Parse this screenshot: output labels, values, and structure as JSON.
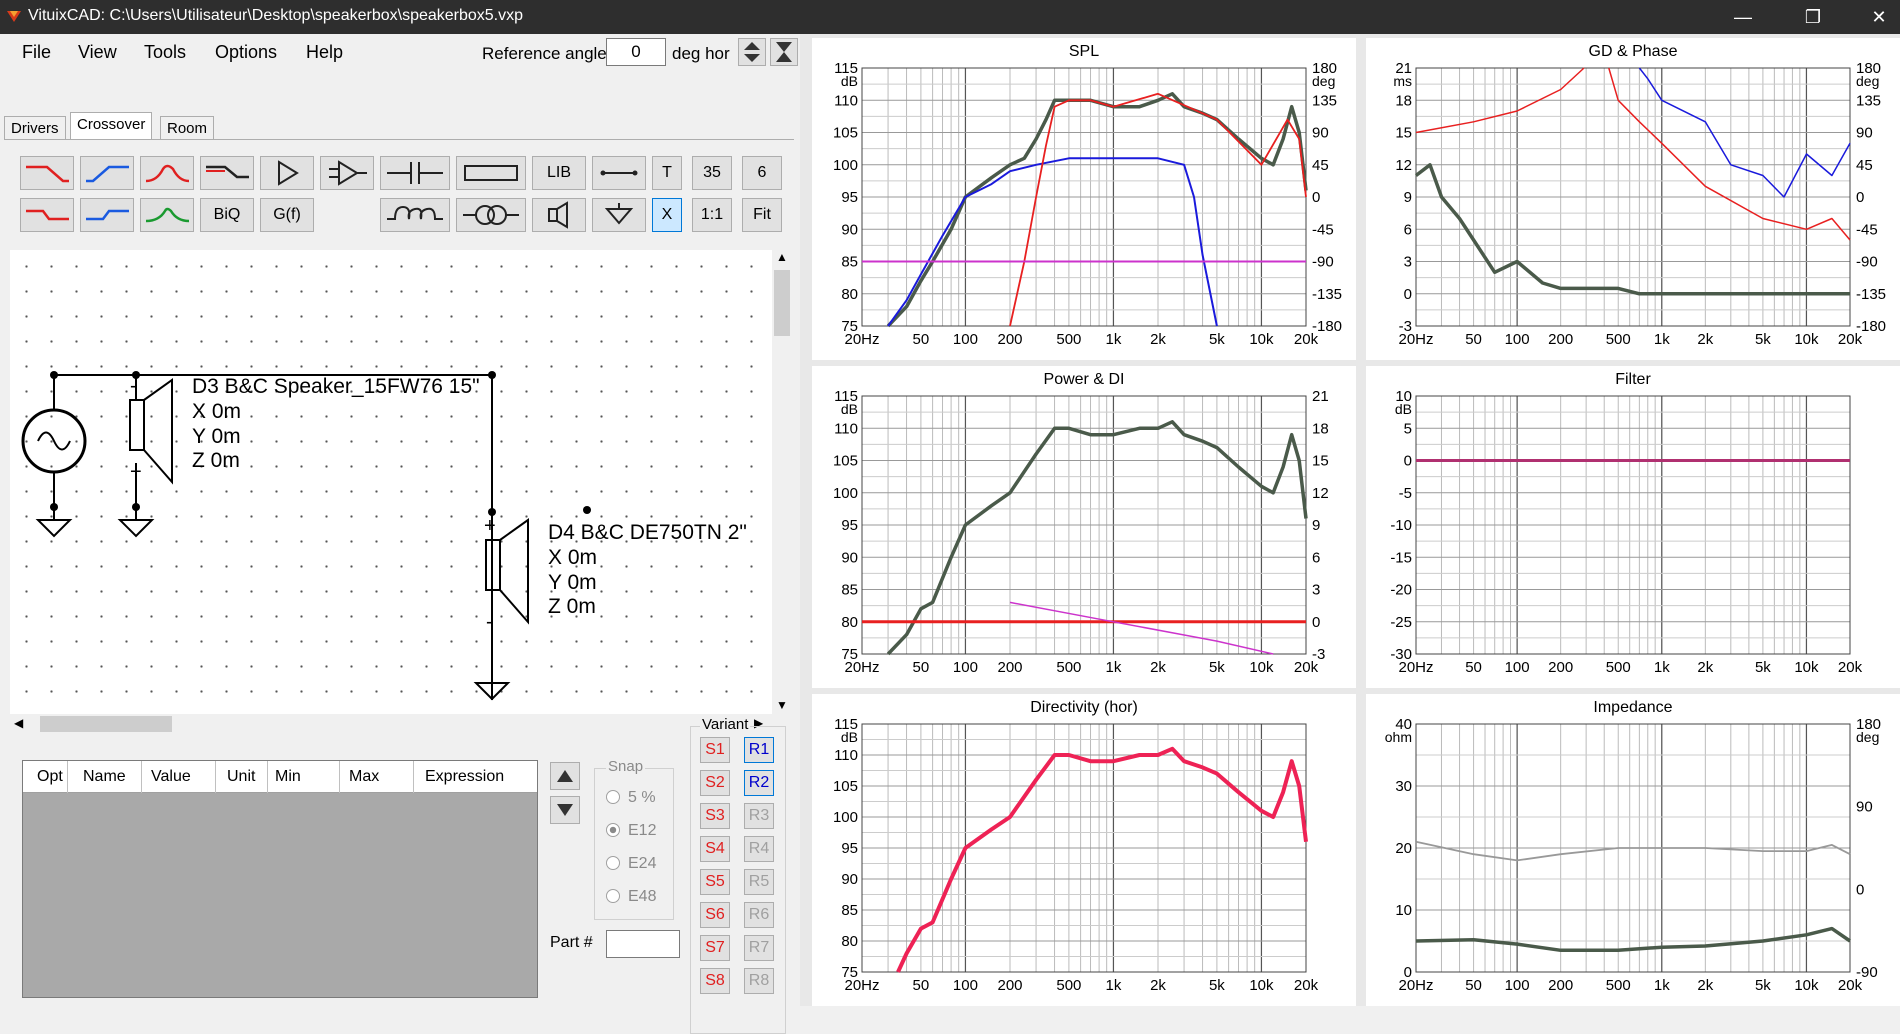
{
  "window": {
    "title": "VituixCAD: C:\\Users\\Utilisateur\\Desktop\\speakerbox\\speakerbox5.vxp"
  },
  "menu": [
    "File",
    "View",
    "Tools",
    "Options",
    "Help"
  ],
  "reference": {
    "label": "Reference angle",
    "value": "0",
    "unit": "deg hor"
  },
  "tabs": [
    "Drivers",
    "Crossover",
    "Room"
  ],
  "toolbar": {
    "lib": "LIB",
    "t": "T",
    "n35": "35",
    "n6": "6",
    "biq": "BiQ",
    "gf": "G(f)",
    "x": "X",
    "oneone": "1:1",
    "fit": "Fit"
  },
  "circuit": {
    "d3": {
      "name": "D3 B&C Speaker_15FW76 15\"",
      "x": "X 0m",
      "y": "Y 0m",
      "z": "Z 0m"
    },
    "d4": {
      "name": "D4 B&C DE750TN 2\"",
      "x": "X 0m",
      "y": "Y 0m",
      "z": "Z 0m"
    }
  },
  "table": {
    "headers": [
      "Opt",
      "Name",
      "Value",
      "Unit",
      "Min",
      "Max",
      "Expression"
    ]
  },
  "snap": {
    "label": "Snap",
    "options": [
      "5 %",
      "E12",
      "E24",
      "E48"
    ],
    "selected": "E12"
  },
  "part": {
    "label": "Part #"
  },
  "variant": {
    "label": "Variant",
    "s": [
      "S1",
      "S2",
      "S3",
      "S4",
      "S5",
      "S6",
      "S7",
      "S8"
    ],
    "r": [
      "R1",
      "R2",
      "R3",
      "R4",
      "R5",
      "R6",
      "R7",
      "R8"
    ],
    "active_r": [
      "R1",
      "R2"
    ]
  },
  "colors": {
    "spl_total": "#4a5a4a",
    "woofer": "#1a1adc",
    "tweeter": "#e82020",
    "target": "#cc33cc",
    "directivity": "#ee2255",
    "filter": "#b03070",
    "grey": "#999999"
  },
  "chart_data": [
    {
      "type": "line",
      "title": "SPL",
      "xlabel": "",
      "ylabel": "dB",
      "y2label": "deg",
      "x_ticks": [
        "20Hz",
        "50",
        "100",
        "200",
        "500",
        "1k",
        "2k",
        "5k",
        "10k",
        "20k"
      ],
      "y_ticks": [
        "115",
        "110",
        "105",
        "100",
        "95",
        "90",
        "85",
        "80",
        "75"
      ],
      "y2_ticks": [
        "180",
        "135",
        "90",
        "45",
        "0",
        "-45",
        "-90",
        "-135",
        "-180"
      ],
      "ylim": [
        75,
        115
      ],
      "y2lim": [
        -180,
        180
      ],
      "grid": true,
      "series": [
        {
          "x": [
            30,
            40,
            50,
            60,
            80,
            100,
            150,
            200,
            250,
            300,
            350,
            400,
            500,
            700,
            1000,
            1500,
            2000,
            2500,
            3000,
            4000,
            5000,
            7000,
            10000,
            12000,
            14000,
            16000,
            18000,
            20000
          ],
          "y": [
            75,
            78,
            82,
            85,
            90,
            95,
            98,
            100,
            101,
            104,
            107,
            110,
            110,
            110,
            109,
            109,
            110,
            111,
            109,
            108,
            107,
            104,
            101,
            100,
            104,
            109,
            105,
            96
          ]
        },
        {
          "x": [
            30,
            40,
            50,
            70,
            100,
            150,
            200,
            300,
            500,
            800,
            1000,
            2000,
            3000,
            3500,
            4000,
            5000
          ],
          "y": [
            75,
            79,
            83,
            89,
            95,
            97,
            99,
            100,
            101,
            101,
            101,
            101,
            100,
            95,
            86,
            75
          ]
        },
        {
          "x": [
            200,
            250,
            300,
            350,
            400,
            500,
            700,
            1000,
            2000,
            5000,
            10000,
            15000,
            18000,
            20000
          ],
          "y": [
            75,
            85,
            95,
            103,
            109,
            110,
            110,
            109,
            111,
            107,
            100,
            107,
            104,
            95
          ]
        },
        {
          "x": [
            20,
            20000
          ],
          "y": [
            85,
            85
          ]
        }
      ]
    },
    {
      "type": "line",
      "title": "GD & Phase",
      "ylabel": "ms",
      "y2label": "deg",
      "x_ticks": [
        "20Hz",
        "50",
        "100",
        "200",
        "500",
        "1k",
        "2k",
        "5k",
        "10k",
        "20k"
      ],
      "y_ticks": [
        "21",
        "18",
        "15",
        "12",
        "9",
        "6",
        "3",
        "0",
        "-3"
      ],
      "y2_ticks": [
        "180",
        "135",
        "90",
        "45",
        "0",
        "-45",
        "-90",
        "-135",
        "-180"
      ],
      "ylim": [
        -3,
        21
      ],
      "grid": true,
      "series": [
        {
          "x": [
            20,
            25,
            30,
            40,
            50,
            70,
            100,
            150,
            200,
            300,
            500,
            700,
            1000,
            20000
          ],
          "y": [
            11,
            12,
            9,
            7,
            5,
            2,
            3,
            1,
            0.5,
            0.5,
            0.5,
            0,
            0,
            0
          ]
        },
        {
          "x": [
            700,
            800,
            1000,
            2000,
            3000,
            5000,
            7000,
            10000,
            15000,
            20000
          ],
          "y": [
            21,
            20,
            18,
            16,
            12,
            11,
            9,
            13,
            11,
            14
          ]
        },
        {
          "x": [
            20,
            50,
            100,
            200,
            290
          ],
          "y": [
            15,
            16,
            17,
            19,
            21
          ]
        },
        {
          "x": [
            430,
            500,
            700,
            1000,
            2000,
            5000,
            10000,
            15000,
            20000
          ],
          "y": [
            21,
            18,
            16,
            14,
            10,
            7,
            6,
            7,
            5
          ]
        }
      ]
    },
    {
      "type": "line",
      "title": "Power & DI",
      "ylabel": "dB",
      "x_ticks": [
        "20Hz",
        "50",
        "100",
        "200",
        "500",
        "1k",
        "2k",
        "5k",
        "10k",
        "20k"
      ],
      "y_ticks": [
        "115",
        "110",
        "105",
        "100",
        "95",
        "90",
        "85",
        "80",
        "75"
      ],
      "y2_ticks": [
        "21",
        "18",
        "15",
        "12",
        "9",
        "6",
        "3",
        "0",
        "-3"
      ],
      "ylim": [
        75,
        115
      ],
      "grid": true,
      "series": [
        {
          "x": [
            30,
            40,
            50,
            60,
            80,
            100,
            150,
            200,
            300,
            400,
            500,
            700,
            1000,
            1500,
            2000,
            2500,
            3000,
            4000,
            5000,
            7000,
            10000,
            12000,
            14000,
            16000,
            18000,
            20000
          ],
          "y": [
            75,
            78,
            82,
            83,
            90,
            95,
            98,
            100,
            106,
            110,
            110,
            109,
            109,
            110,
            110,
            111,
            109,
            108,
            107,
            104,
            101,
            100,
            104,
            109,
            105,
            96
          ]
        },
        {
          "x": [
            20,
            20000
          ],
          "y": [
            80,
            80
          ]
        },
        {
          "x": [
            200,
            1000,
            5000,
            12000
          ],
          "y": [
            83,
            80,
            77,
            75
          ]
        }
      ]
    },
    {
      "type": "line",
      "title": "Filter",
      "ylabel": "dB",
      "x_ticks": [
        "20Hz",
        "50",
        "100",
        "200",
        "500",
        "1k",
        "2k",
        "5k",
        "10k",
        "20k"
      ],
      "y_ticks": [
        "10",
        "5",
        "0",
        "-5",
        "-10",
        "-15",
        "-20",
        "-25",
        "-30"
      ],
      "ylim": [
        -30,
        10
      ],
      "grid": true,
      "series": [
        {
          "x": [
            20,
            20000
          ],
          "y": [
            0,
            0
          ]
        }
      ]
    },
    {
      "type": "line",
      "title": "Directivity (hor)",
      "ylabel": "dB",
      "x_ticks": [
        "20Hz",
        "50",
        "100",
        "200",
        "500",
        "1k",
        "2k",
        "5k",
        "10k",
        "20k"
      ],
      "y_ticks": [
        "115",
        "110",
        "105",
        "100",
        "95",
        "90",
        "85",
        "80",
        "75"
      ],
      "ylim": [
        75,
        115
      ],
      "grid": true,
      "series": [
        {
          "x": [
            35,
            40,
            50,
            60,
            80,
            100,
            150,
            200,
            300,
            400,
            500,
            700,
            1000,
            1500,
            2000,
            2500,
            3000,
            4000,
            5000,
            7000,
            10000,
            12000,
            14000,
            16000,
            18000,
            20000
          ],
          "y": [
            75,
            78,
            82,
            83,
            90,
            95,
            98,
            100,
            106,
            110,
            110,
            109,
            109,
            110,
            110,
            111,
            109,
            108,
            107,
            104,
            101,
            100,
            104,
            109,
            105,
            96
          ]
        }
      ]
    },
    {
      "type": "line",
      "title": "Impedance",
      "ylabel": "ohm",
      "y2label": "deg",
      "x_ticks": [
        "20Hz",
        "50",
        "100",
        "200",
        "500",
        "1k",
        "2k",
        "5k",
        "10k",
        "20k"
      ],
      "y_ticks": [
        "40",
        "30",
        "20",
        "10",
        "0"
      ],
      "y2_ticks": [
        "180",
        "90",
        "0",
        "-90"
      ],
      "ylim": [
        0,
        40
      ],
      "grid": true,
      "series": [
        {
          "x": [
            20,
            50,
            100,
            200,
            500,
            1000,
            2000,
            5000,
            10000,
            15000,
            20000
          ],
          "y": [
            5,
            5.2,
            4.5,
            3.5,
            3.5,
            4,
            4.2,
            5,
            6,
            7,
            5
          ]
        },
        {
          "x": [
            20,
            50,
            100,
            200,
            500,
            1000,
            2000,
            5000,
            10000,
            15000,
            20000
          ],
          "y": [
            21,
            19,
            18,
            19,
            20,
            20,
            20,
            19.5,
            19.5,
            20.5,
            19
          ]
        }
      ]
    }
  ]
}
